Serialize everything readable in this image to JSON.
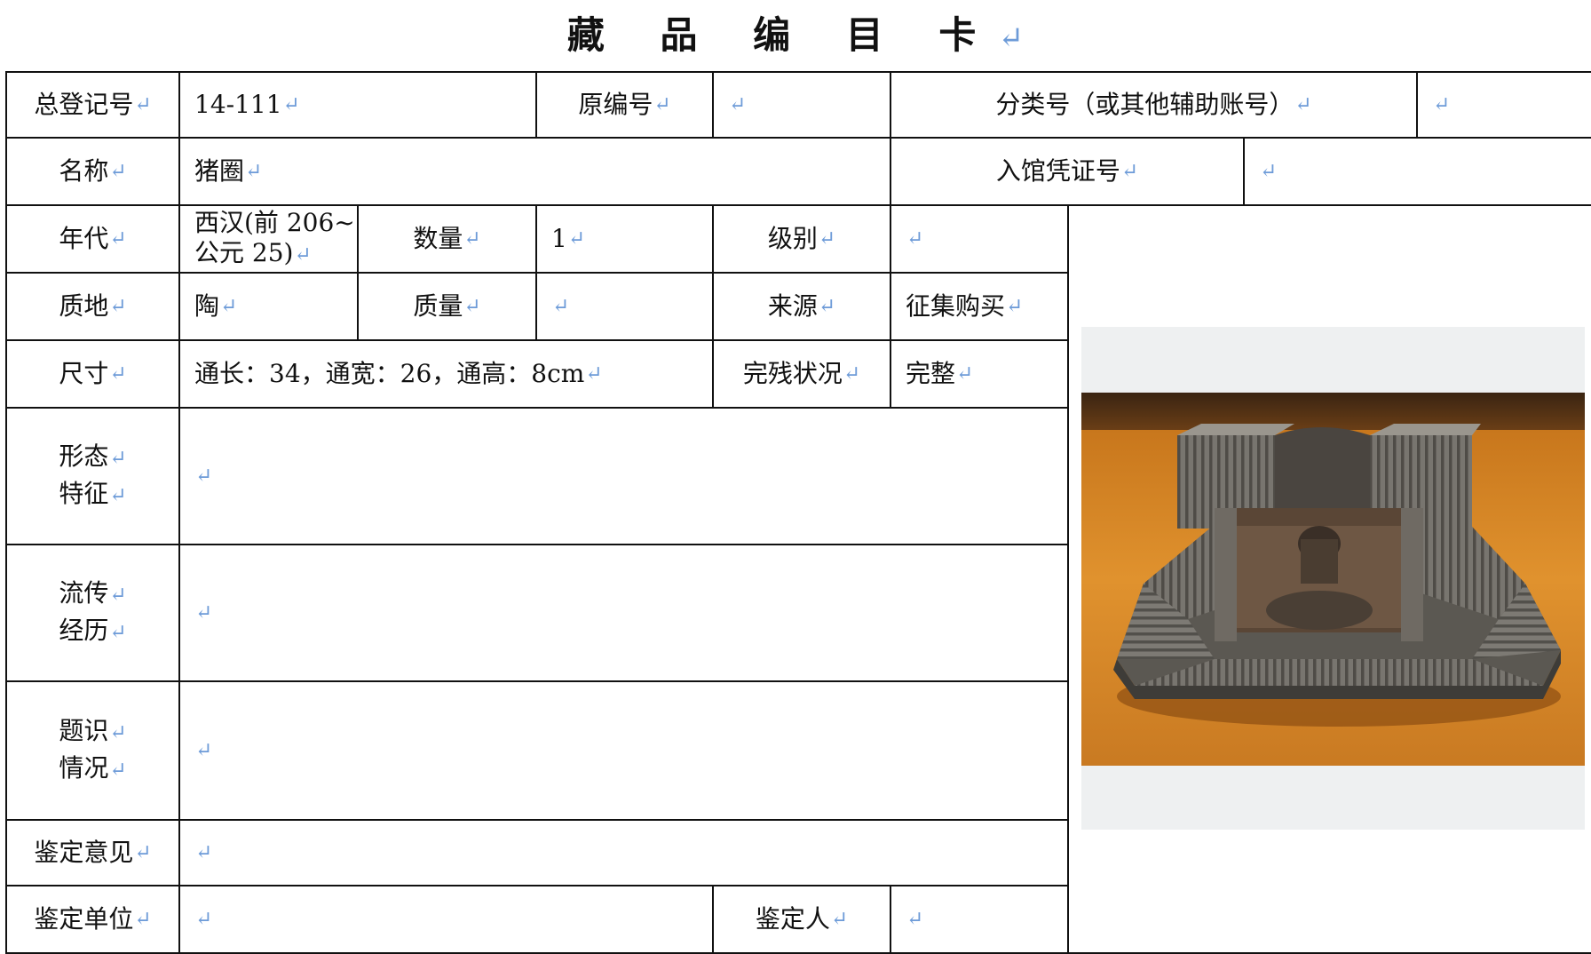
{
  "title": "藏 品 编 目 卡",
  "para_mark": "↵",
  "fields": {
    "total_reg_no": {
      "label": "总登记号",
      "value": "14-111"
    },
    "original_no": {
      "label": "原编号",
      "value": ""
    },
    "class_no": {
      "label": "分类号（或其他辅助账号）",
      "value": ""
    },
    "name": {
      "label": "名称",
      "value": "猪圈"
    },
    "entry_voucher_no": {
      "label": "入馆凭证号",
      "value": ""
    },
    "era": {
      "label": "年代",
      "value_line1": "西汉(前 206~",
      "value_line2": "公元 25)"
    },
    "quantity": {
      "label": "数量",
      "value": "1"
    },
    "grade": {
      "label": "级别",
      "value": ""
    },
    "material": {
      "label": "质地",
      "value": "陶"
    },
    "mass": {
      "label": "质量",
      "value": ""
    },
    "source": {
      "label": "来源",
      "value": "征集购买"
    },
    "dimensions": {
      "label": "尺寸",
      "value": "通长：34，通宽：26，通高：8cm"
    },
    "condition": {
      "label": "完残状况",
      "value": "完整"
    },
    "shape": {
      "label_line1": "形态",
      "label_line2": "特征",
      "value": ""
    },
    "provenance": {
      "label_line1": "流传",
      "label_line2": "经历",
      "value": ""
    },
    "inscription": {
      "label_line1": "题识",
      "label_line2": "情况",
      "value": ""
    },
    "appraisal_opinion": {
      "label": "鉴定意见",
      "value": ""
    },
    "appraisal_unit": {
      "label": "鉴定单位",
      "value": ""
    },
    "appraiser": {
      "label": "鉴定人",
      "value": ""
    }
  },
  "photo": {
    "subject": "pottery-pig-pen",
    "colors": {
      "background": "#d9852a",
      "pottery": "#6f6c66"
    }
  }
}
